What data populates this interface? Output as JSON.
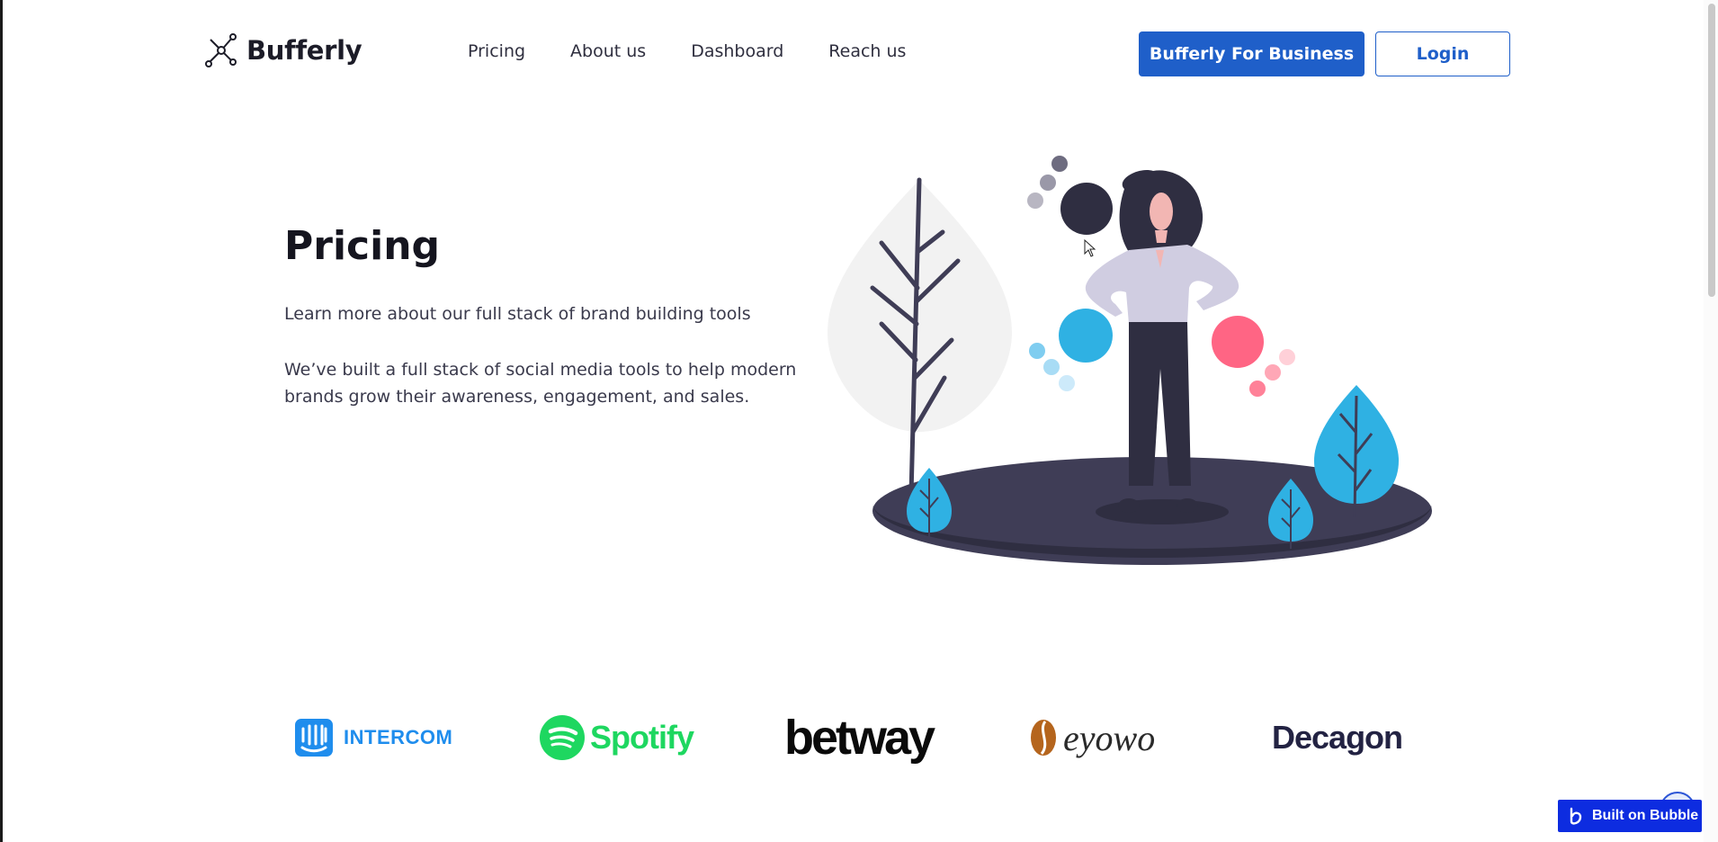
{
  "brand": {
    "name": "Bufferly",
    "logo_icon": "network-nodes-icon"
  },
  "nav": {
    "items": [
      {
        "label": "Pricing"
      },
      {
        "label": "About us"
      },
      {
        "label": "Dashboard"
      },
      {
        "label": "Reach us"
      }
    ]
  },
  "header": {
    "business_button": "Bufferly For Business",
    "login_button": "Login"
  },
  "hero": {
    "title": "Pricing",
    "subtitle": "Learn more about our full stack of brand building tools",
    "description": "We’ve built a full stack of social media tools to help modern brands grow their awareness, engagement, and sales.",
    "illustration": "woman-standing-with-plants-illustration"
  },
  "client_logos": {
    "intercom": "INTERCOM",
    "spotify": "Spotify",
    "betway": "betway",
    "eyowo": "eyowo",
    "decagon": "Decagon"
  },
  "badge": {
    "label": "Built on Bubble"
  },
  "colors": {
    "primary": "#1f5fc9",
    "text_dark": "#15151f",
    "illustration_dark": "#2f2e41",
    "illustration_blue": "#2fb1e3",
    "illustration_pink": "#ff6584"
  }
}
